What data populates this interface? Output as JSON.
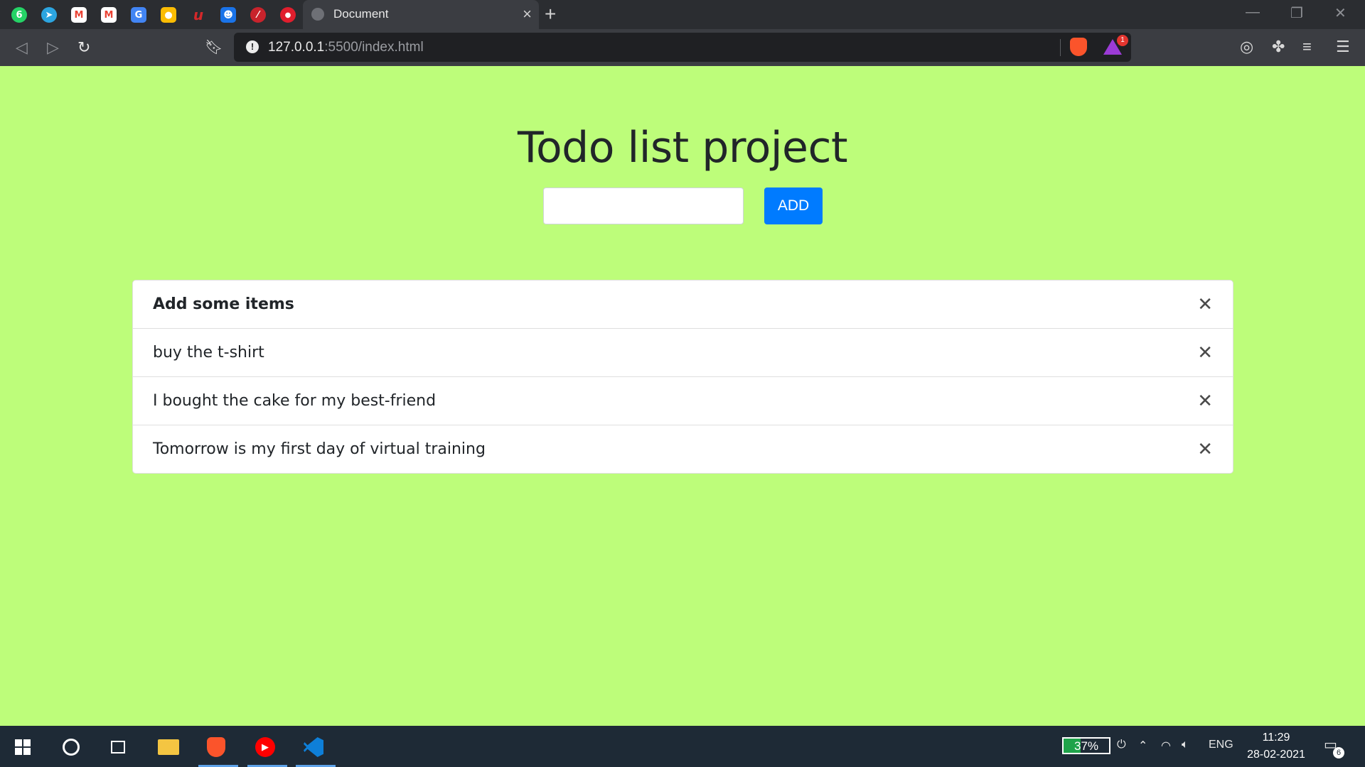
{
  "browser": {
    "pinned_tabs": [
      {
        "icon": "whatsapp-icon",
        "glyph": "6",
        "color": "#25d366"
      },
      {
        "icon": "telegram-icon",
        "glyph": "➤",
        "color": "#2ca5e0"
      },
      {
        "icon": "gmail-icon",
        "glyph": "M",
        "color": "#ea4335"
      },
      {
        "icon": "gmail-icon",
        "glyph": "M",
        "color": "#ea4335"
      },
      {
        "icon": "google-translate-icon",
        "glyph": "G",
        "color": "#4285f4"
      },
      {
        "icon": "google-keep-icon",
        "glyph": "●",
        "color": "#fbbc04"
      },
      {
        "icon": "brand-icon",
        "glyph": "u",
        "color": "#d4282a"
      },
      {
        "icon": "contacts-icon",
        "glyph": "☻",
        "color": "#1a73e8"
      },
      {
        "icon": "slash-app-icon",
        "glyph": "⁄",
        "color": "#c8232c"
      },
      {
        "icon": "chat-icon",
        "glyph": "●",
        "color": "#e01e2d"
      }
    ],
    "active_tab": {
      "title": "Document"
    },
    "address": {
      "host": "127.0.0.1",
      "rest": ":5500/index.html"
    },
    "rewards_badge": "1"
  },
  "page": {
    "title": "Todo list project",
    "input_value": "",
    "add_label": "ADD",
    "header_item": "Add some items",
    "items": [
      "buy the t-shirt",
      "I bought the cake for my best-friend",
      "Tomorrow is my first day of virtual training"
    ],
    "close_glyph": "✕"
  },
  "taskbar": {
    "battery": "37%",
    "battery_level": 0.37,
    "language": "ENG",
    "time": "11:29",
    "date": "28-02-2021",
    "notifications": "6"
  }
}
